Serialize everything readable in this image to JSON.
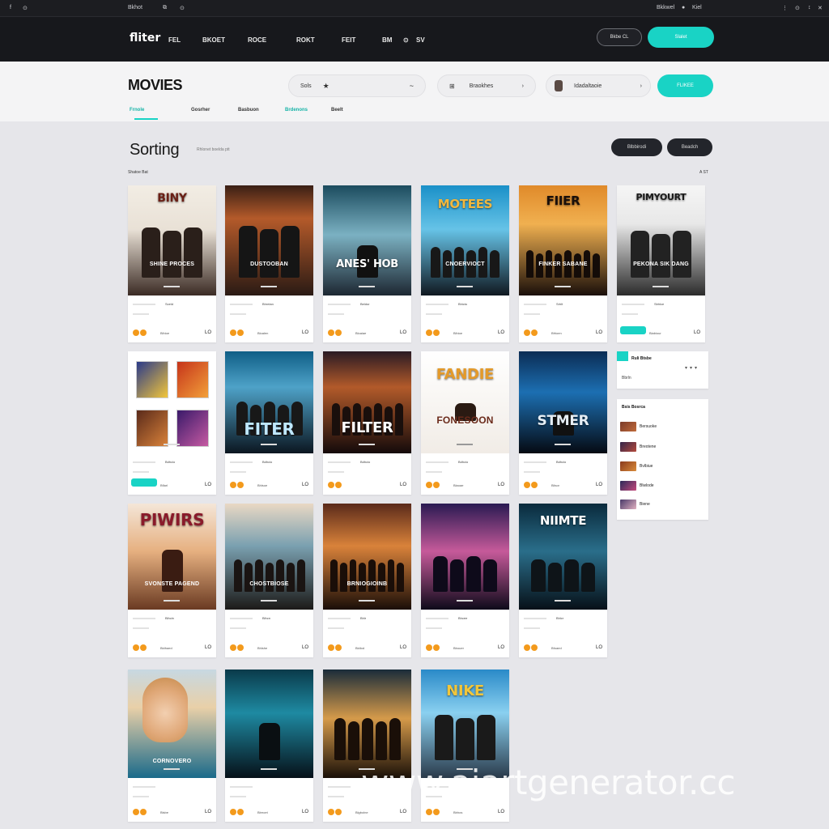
{
  "sysbar": {
    "left_a": "f",
    "left_b": "⊙",
    "center_a": "Bkhot",
    "center_b": "⧉",
    "center_c": "⊙",
    "right_a": "Bkkwel",
    "right_b": "●",
    "right_c": "Kiel",
    "right_d": "⋮",
    "right_e": "⊙",
    "right_f": "↕",
    "right_g": "✕"
  },
  "nav": {
    "logo": "fliter",
    "links": [
      "FEL",
      "BKOET",
      "ROCE",
      "ROKT",
      "FEIT",
      "BM",
      "⊙",
      "SV"
    ],
    "signin": "Bkbe CL",
    "signup": "Slalet"
  },
  "header": {
    "title": "MOVIES",
    "search_text": "Sols",
    "search_star": "★",
    "search_wave": "~",
    "genre_icon": "⊞",
    "genre_text": "Braokhes",
    "genre_arrow": "›",
    "user_text": "Idadaltaoie",
    "user_arrow": "›",
    "filter_btn": "FLIKEE"
  },
  "tabs": [
    {
      "label": "Frnole"
    },
    {
      "label": "Gosrher"
    },
    {
      "label": "Basbuon"
    },
    {
      "label": "Brdenons"
    },
    {
      "label": "Beelt"
    }
  ],
  "sorting": {
    "title": "Sorting",
    "subtitle": "Rhlonet boelda ptt",
    "chip1": "Blbbirodi",
    "chip2": "Beadch",
    "meta_left": "Shatoe Bat",
    "meta_right": "A ST"
  },
  "cards": [
    {
      "title": "BINY",
      "subtitle": "SHINE PROCES",
      "label": "Sceld",
      "genre": "Blhioe",
      "year": "LO"
    },
    {
      "title": "",
      "subtitle": "DUSTOOBAN",
      "label": "Bhrelan",
      "genre": "Bloalen",
      "year": "LO"
    },
    {
      "title": "ANES' HOB",
      "subtitle": "",
      "label": "Beldor",
      "genre": "Bloaiae",
      "year": "LO"
    },
    {
      "title": "MOTEES",
      "subtitle": "CNOERVIOCT",
      "label": "Bhicto",
      "genre": "Blhioe",
      "year": "LO"
    },
    {
      "title": "FIIER",
      "subtitle": "FINKER SABANE",
      "label": "Srhlt",
      "genre": "Bfrloen",
      "year": "LO"
    },
    {
      "title": "PIMYOURT",
      "subtitle": "PEKONA SIK DANG",
      "label": "Sbhlce",
      "genre": "Blabiour",
      "year": "LO"
    },
    {
      "title": "",
      "subtitle": "",
      "label": "Bdhcio",
      "genre": "Bflarl",
      "year": "LO"
    },
    {
      "title": "FITER",
      "subtitle": "",
      "label": "Bdhcio",
      "genre": "Bhlsoe",
      "year": "LO"
    },
    {
      "title": "FILTER",
      "subtitle": "",
      "label": "Bdhcio",
      "genre": "",
      "year": "LO"
    },
    {
      "title": "FANDIE",
      "subtitle": "FONESOON",
      "label": "Bdhcio",
      "genre": "Blaoae",
      "year": "LO"
    },
    {
      "title": "STMER",
      "subtitle": "",
      "label": "Bdhcio",
      "genre": "Blisor",
      "year": "LO"
    },
    {
      "title": "PIWIRS",
      "subtitle": "SVONSTE PAGEND",
      "label": "Blhcin",
      "genre": "Bldhaed",
      "year": "LO"
    },
    {
      "title": "",
      "subtitle": "CHOSTBIOSE",
      "label": "Blhcn",
      "genre": "Bhlshe",
      "year": "LO"
    },
    {
      "title": "",
      "subtitle": "BRNIOGIOINB",
      "label": "Bhlr",
      "genre": "Bldlod",
      "year": "LO"
    },
    {
      "title": "",
      "subtitle": "",
      "label": "Bhcee",
      "genre": "Bbouer",
      "year": "LO"
    },
    {
      "title": "NIIMTE",
      "subtitle": "",
      "label": "Bhlcr",
      "genre": "Bfoaed",
      "year": "LO"
    },
    {
      "title": "",
      "subtitle": "CORNOVERO",
      "label": "",
      "genre": "Blsbe",
      "year": "LO"
    },
    {
      "title": "",
      "subtitle": "",
      "label": "",
      "genre": "Blreoet",
      "year": "LO"
    },
    {
      "title": "",
      "subtitle": "",
      "label": "",
      "genre": "Blgbolne",
      "year": "LO"
    },
    {
      "title": "NIKE",
      "subtitle": "",
      "label": "",
      "genre": "Bbhos",
      "year": "LO"
    }
  ],
  "card7_thumb_labels": [
    "",
    "",
    "",
    ""
  ],
  "side_panel1": {
    "title": "Ruli Btsbe",
    "subtitle": "Bbrln",
    "arrows": "▾▾▾"
  },
  "side_panel2": {
    "title": "Bsis Bosrca",
    "items": [
      "Bersuoke",
      "Breotene",
      "Bvlbiue",
      "Blwlode",
      "Biene"
    ]
  },
  "watermark": "www.aiartgenerator.cc",
  "colors": {
    "accent": "#19d3c5",
    "rating": "#f39a1c",
    "nav_bg": "#17181c"
  }
}
